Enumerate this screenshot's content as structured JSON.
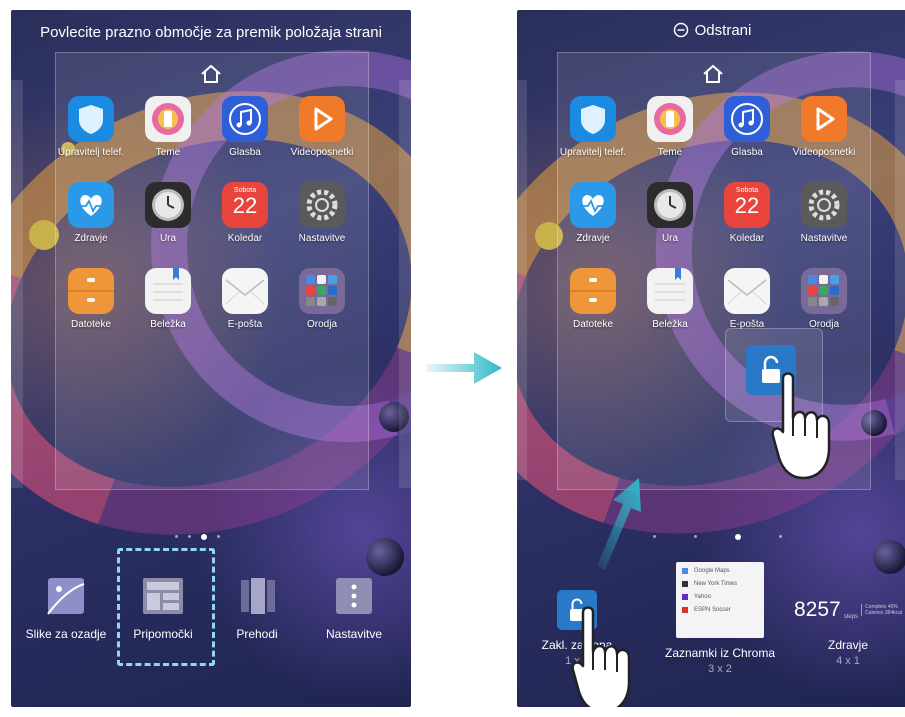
{
  "left": {
    "hint": "Povlecite prazno območje za premik položaja strani",
    "apps": [
      {
        "label": "Upravitelj telef.",
        "icon": "shield-icon",
        "color": "#1a8be0"
      },
      {
        "label": "Teme",
        "icon": "brush-icon",
        "color": "#f0f0f0"
      },
      {
        "label": "Glasba",
        "icon": "music-note-icon",
        "color": "#2f5fd8"
      },
      {
        "label": "Videoposnetki",
        "icon": "play-icon",
        "color": "#f07a2a"
      },
      {
        "label": "Zdravje",
        "icon": "heart-pulse-icon",
        "color": "#2a9ae8"
      },
      {
        "label": "Ura",
        "icon": "clock-icon",
        "color": "#444"
      },
      {
        "label": "Koledar",
        "icon": "calendar-icon",
        "color": "#e8453c"
      },
      {
        "label": "Nastavitve",
        "icon": "gear-icon",
        "color": "#666"
      },
      {
        "label": "Datoteke",
        "icon": "folder-icon",
        "color": "#f0963a"
      },
      {
        "label": "Beležka",
        "icon": "notepad-icon",
        "color": "#f2f2f2"
      },
      {
        "label": "E-pošta",
        "icon": "mail-icon",
        "color": "#f5f5f5"
      },
      {
        "label": "Orodja",
        "icon": "folder-grid-icon",
        "color": "#7a6a9a"
      }
    ],
    "calendar_day": "Sobota",
    "calendar_date": "22",
    "bottom": [
      {
        "label": "Slike za ozadje",
        "icon": "wallpaper-icon"
      },
      {
        "label": "Pripomočki",
        "icon": "widgets-icon"
      },
      {
        "label": "Prehodi",
        "icon": "transitions-icon"
      },
      {
        "label": "Nastavitve",
        "icon": "settings-dots-icon"
      }
    ]
  },
  "right": {
    "remove_label": "Odstrani",
    "apps": [
      {
        "label": "Upravitelj telef.",
        "icon": "shield-icon",
        "color": "#1a8be0"
      },
      {
        "label": "Teme",
        "icon": "brush-icon",
        "color": "#f0f0f0"
      },
      {
        "label": "Glasba",
        "icon": "music-note-icon",
        "color": "#2f5fd8"
      },
      {
        "label": "Videoposnetki",
        "icon": "play-icon",
        "color": "#f07a2a"
      },
      {
        "label": "Zdravje",
        "icon": "heart-pulse-icon",
        "color": "#2a9ae8"
      },
      {
        "label": "Ura",
        "icon": "clock-icon",
        "color": "#444"
      },
      {
        "label": "Koledar",
        "icon": "calendar-icon",
        "color": "#e8453c"
      },
      {
        "label": "Nastavitve",
        "icon": "gear-icon",
        "color": "#666"
      },
      {
        "label": "Datoteke",
        "icon": "folder-icon",
        "color": "#f0963a"
      },
      {
        "label": "Beležka",
        "icon": "notepad-icon",
        "color": "#f2f2f2"
      },
      {
        "label": "E-pošta",
        "icon": "mail-icon",
        "color": "#f5f5f5"
      },
      {
        "label": "Orodja",
        "icon": "folder-grid-icon",
        "color": "#7a6a9a"
      }
    ],
    "calendar_day": "Sobota",
    "calendar_date": "22",
    "widgets": [
      {
        "label": "Zakl. zaslona",
        "size": "1 x 1"
      },
      {
        "label": "Zaznamki iz Chroma",
        "size": "3 x 2"
      },
      {
        "label": "Zdravje",
        "size": "4 x 1"
      }
    ],
    "bookmarks": [
      "Google Maps",
      "New York Times",
      "Yahoo",
      "ESPN Soccer"
    ],
    "steps_value": "8257",
    "steps_unit": "steps",
    "steps_note1": "Complete 40%",
    "steps_note2": "Calories 384kcal"
  },
  "colors": {
    "arrow": "#2fb8c8",
    "dash": "#8fd8f0",
    "lock_tile": "#2a78c8"
  }
}
